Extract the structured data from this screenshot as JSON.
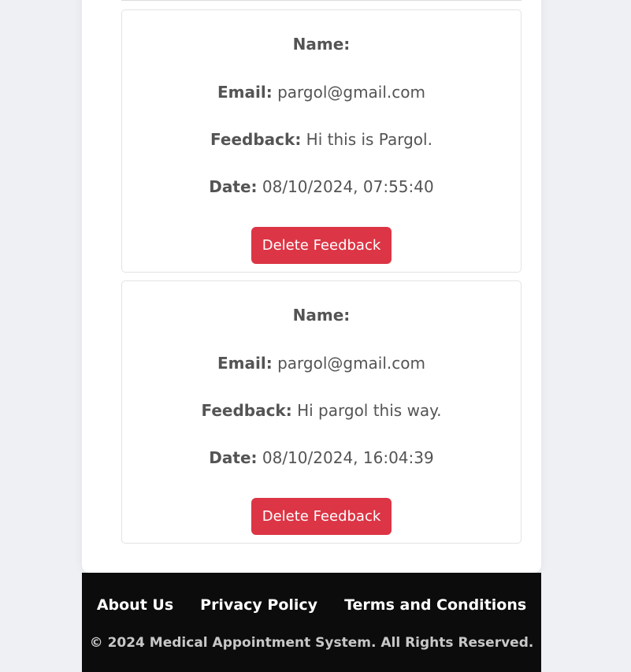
{
  "feedback_list": [
    {
      "name_label": "Name:",
      "name_value": "",
      "email_label": "Email:",
      "email_value": "pargol@gmail.com",
      "feedback_label": "Feedback:",
      "feedback_value": "Hi this is Pargol.",
      "date_label": "Date:",
      "date_value": "08/10/2024, 07:55:40",
      "delete_label": "Delete Feedback"
    },
    {
      "name_label": "Name:",
      "name_value": "",
      "email_label": "Email:",
      "email_value": "pargol@gmail.com",
      "feedback_label": "Feedback:",
      "feedback_value": "Hi pargol this way.",
      "date_label": "Date:",
      "date_value": "08/10/2024, 16:04:39",
      "delete_label": "Delete Feedback"
    }
  ],
  "footer": {
    "links": [
      "About Us",
      "Privacy Policy",
      "Terms and Conditions"
    ],
    "copyright": "© 2024 Medical Appointment System. All Rights Reserved."
  },
  "colors": {
    "delete_button": "#dc3545",
    "footer_background": "#0c0c0c",
    "page_background": "#eef0f4"
  }
}
